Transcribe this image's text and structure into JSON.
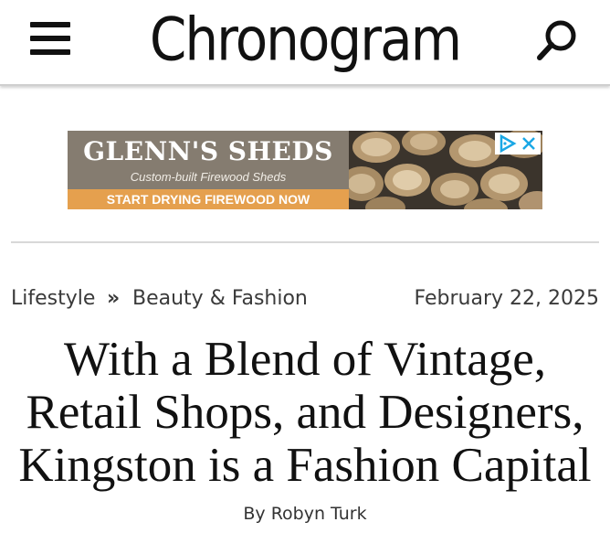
{
  "header": {
    "logo_text": "Chronogram",
    "menu_icon": "hamburger-menu-icon",
    "search_icon": "search-icon"
  },
  "ad": {
    "title": "GLENN'S SHEDS",
    "subtitle": "Custom-built Firewood Sheds",
    "cta": "START DRYING FIREWOOD NOW",
    "image": "firewood-logs-image",
    "adchoices_icon": "adchoices-icon",
    "close_icon": "close-icon",
    "colors": {
      "panel": "#857c70",
      "cta": "#e5a04e",
      "badge_accent": "#1aa7e5"
    }
  },
  "article": {
    "breadcrumb": {
      "category": "Lifestyle",
      "separator": "»",
      "subcategory": "Beauty & Fashion"
    },
    "date": "February 22, 2025",
    "title_lines": [
      "With a Blend of Vintage,",
      "Retail Shops, and Designers,",
      "Kingston is a Fashion Capital"
    ],
    "byline_prefix": "By",
    "author": "Robyn Turk"
  }
}
